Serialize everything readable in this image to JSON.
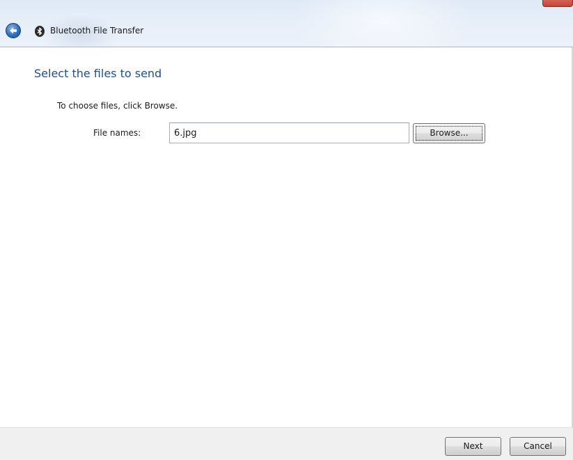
{
  "window": {
    "title": "Bluetooth File Transfer"
  },
  "header": {
    "back_icon": "back-arrow-icon",
    "app_icon": "bluetooth-icon"
  },
  "main": {
    "heading": "Select the files to send",
    "instruction": "To choose files, click Browse.",
    "file_names_label": "File names:",
    "file_names_value": "6.jpg",
    "browse_label": "Browse..."
  },
  "footer": {
    "next_label": "Next",
    "cancel_label": "Cancel"
  },
  "colors": {
    "heading": "#1e4d96",
    "header_bg": "#e6eef8",
    "footer_bg": "#f0f0f0"
  }
}
